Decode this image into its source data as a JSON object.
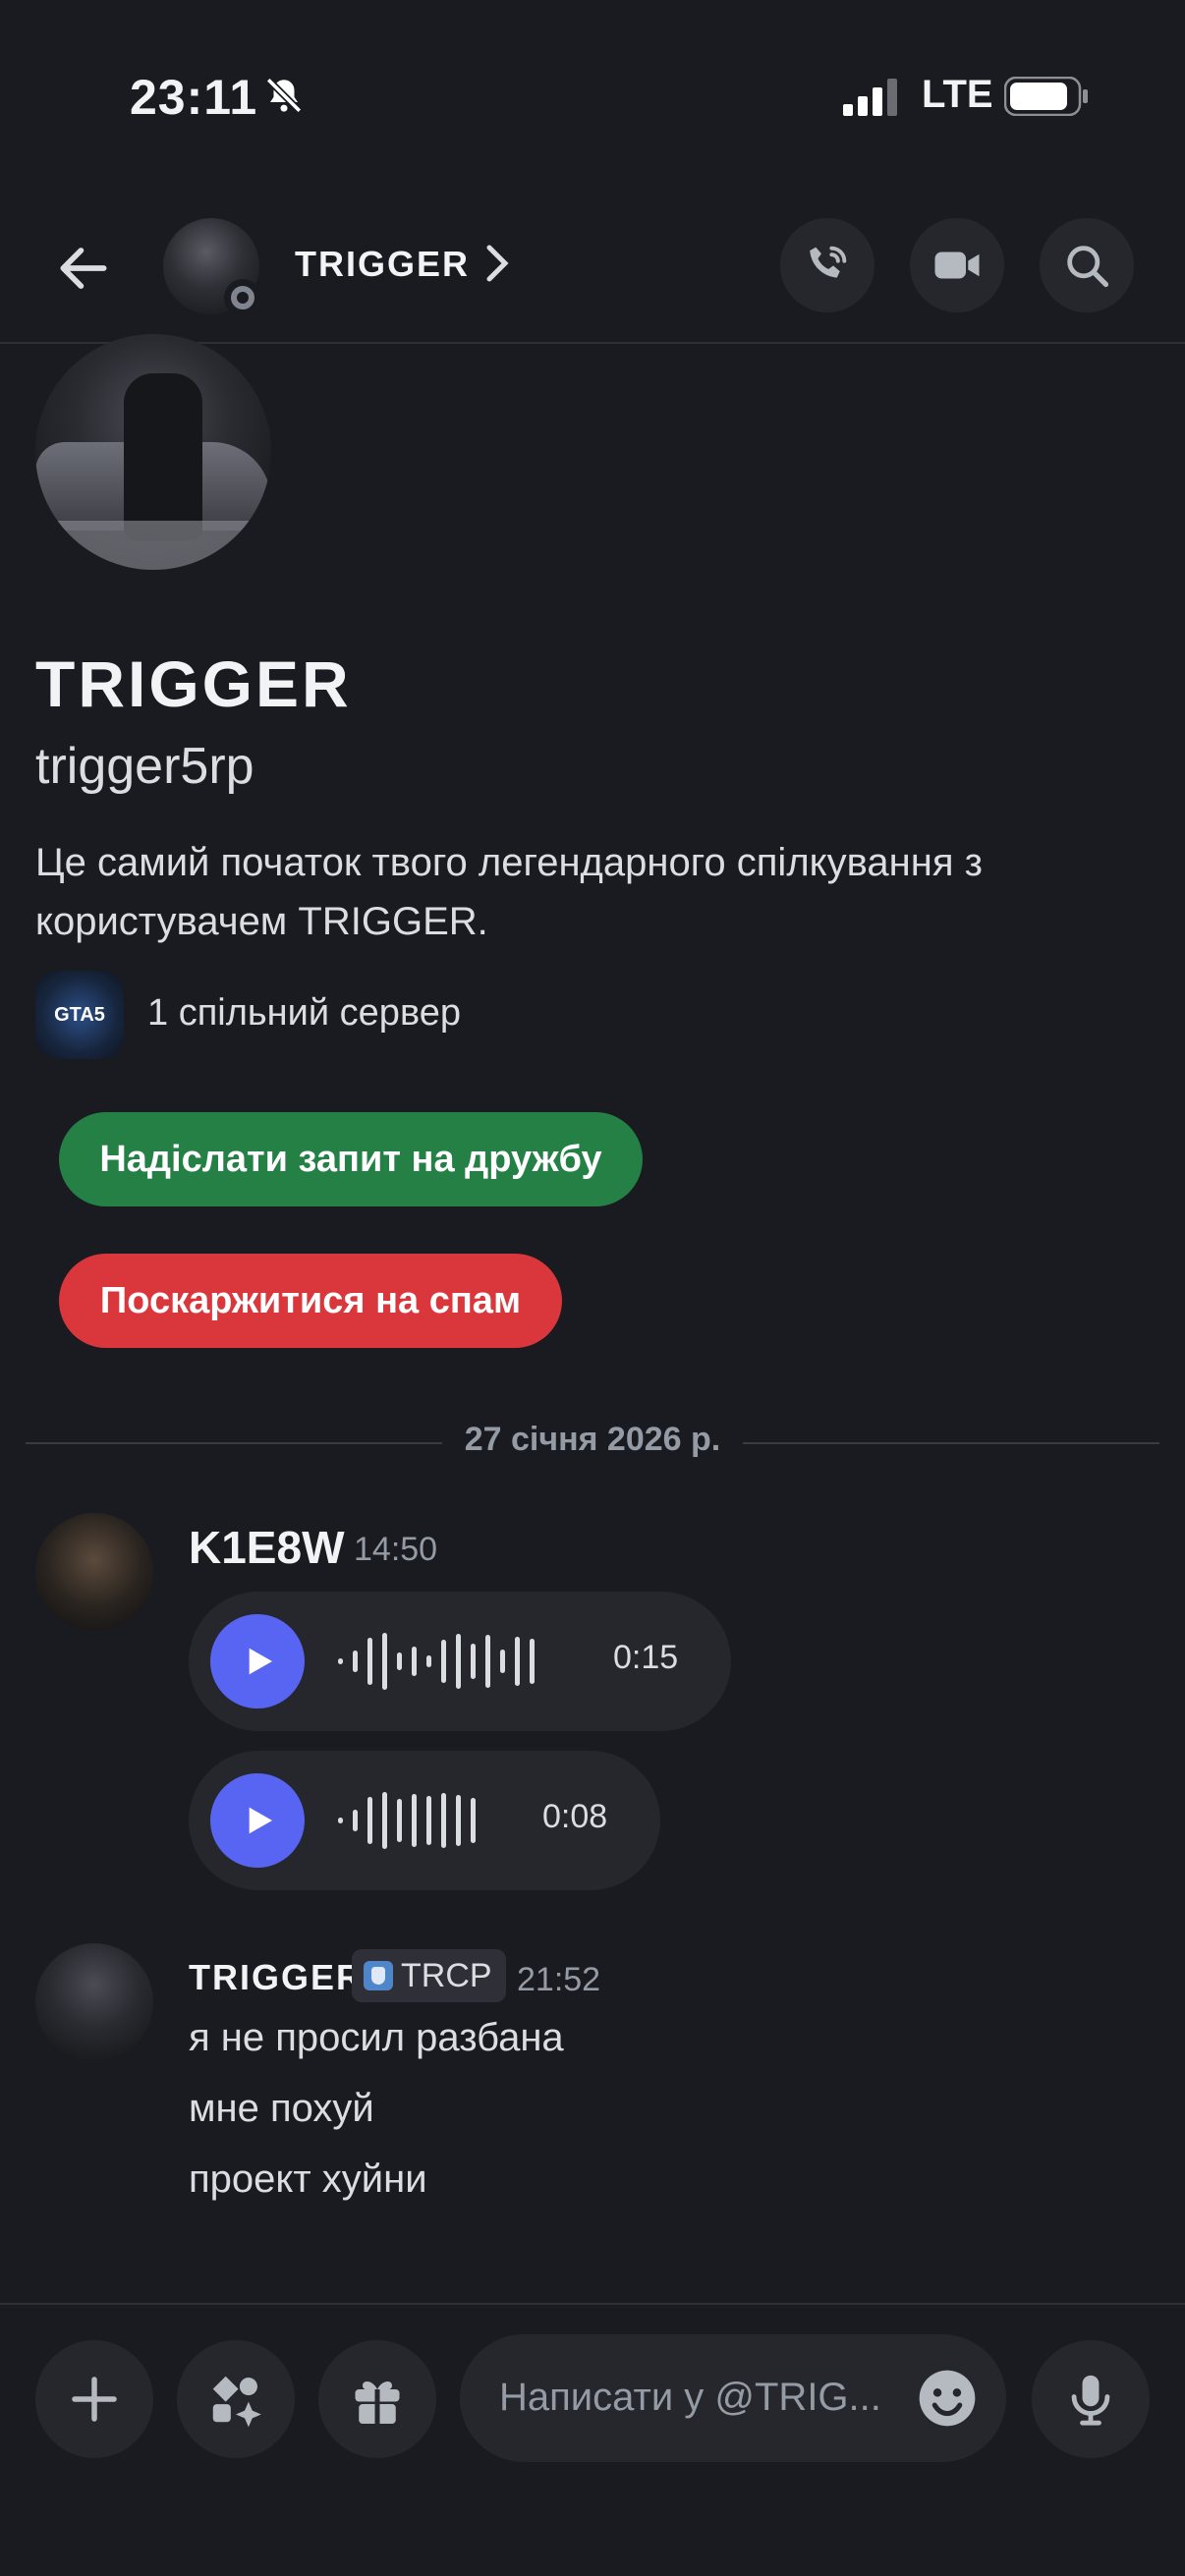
{
  "status_bar": {
    "time": "23:11",
    "network": "LTE"
  },
  "header": {
    "name": "TRIGGER",
    "icons": [
      "back-arrow",
      "chevron-right",
      "phone-call",
      "video-camera",
      "search"
    ]
  },
  "profile": {
    "display_name": "TRIGGER",
    "username": "trigger5rp",
    "intro": "Це самий початок твого легендарного спілкування з користувачем TRIGGER.",
    "mutual_servers": "1 спільний сервер",
    "server_icon_text": "GTA5"
  },
  "actions": {
    "friend_request": "Надіслати запит на дружбу",
    "report_spam": "Поскаржитися на спам"
  },
  "date_divider": "27 січня 2026 р.",
  "messages": [
    {
      "author": "K1E8W",
      "time": "14:50",
      "voice_clips": [
        {
          "duration": "0:15"
        },
        {
          "duration": "0:08"
        }
      ]
    },
    {
      "author": "TRIGGER",
      "tag": "TRCP",
      "time": "21:52",
      "lines": [
        "я не просил разбана",
        "мне похуй",
        "проект хуйни"
      ]
    }
  ],
  "composer": {
    "placeholder": "Написати у @TRIG..."
  },
  "colors": {
    "background": "#1a1b20",
    "friend_button": "#248045",
    "spam_button": "#da373c",
    "play_button": "#5865f2"
  }
}
